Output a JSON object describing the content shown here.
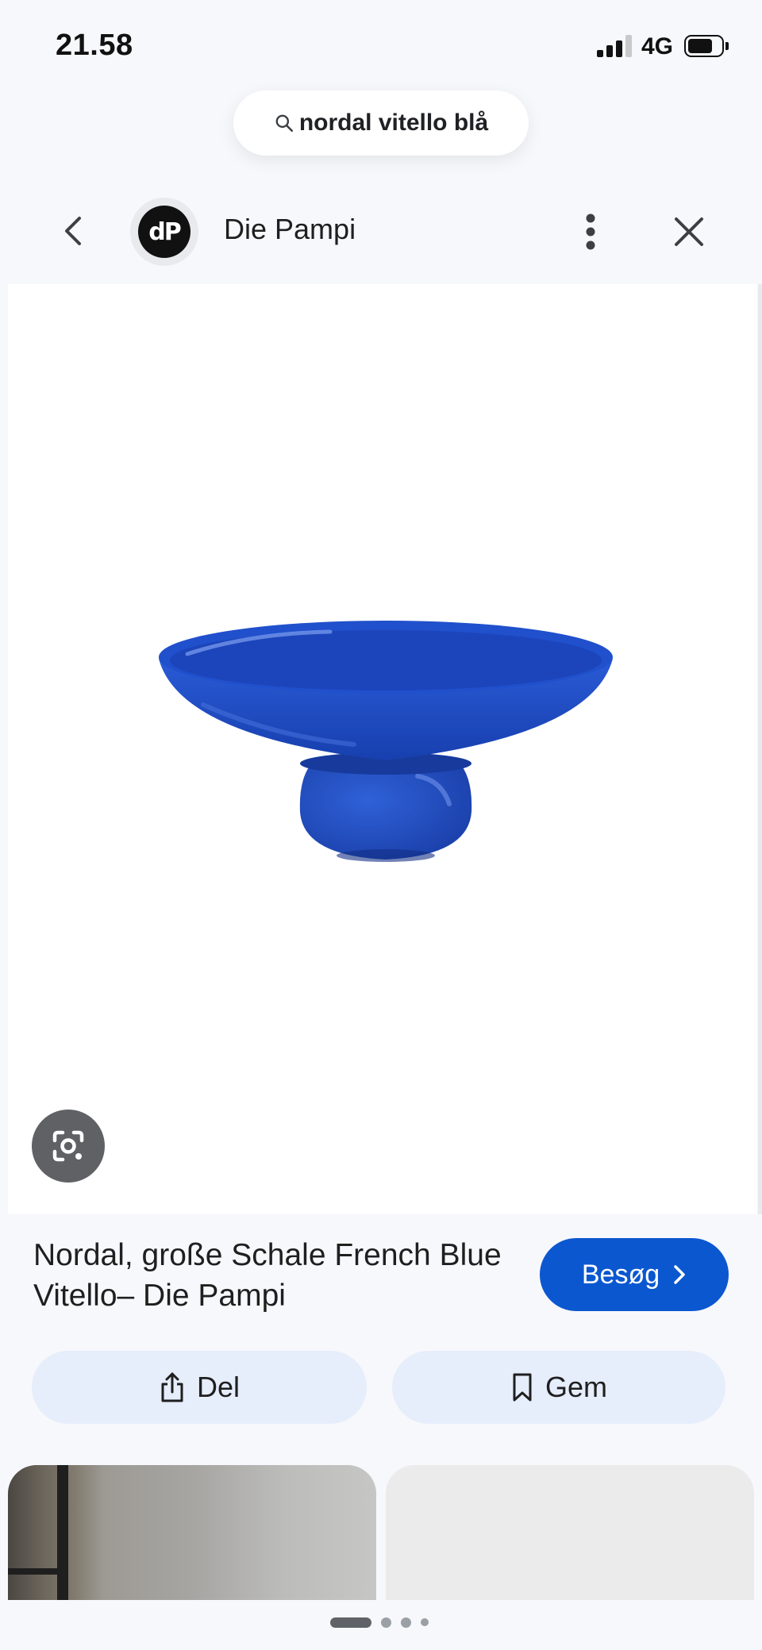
{
  "status_bar": {
    "time": "21.58",
    "network": "4G"
  },
  "search": {
    "query": "nordal vitello blå"
  },
  "header": {
    "source_name": "Die Pampi",
    "avatar_text": "dP"
  },
  "product": {
    "title": "Nordal, große Schale French Blue Vitello– Die Pampi",
    "visit_label": "Besøg",
    "color": "#1f4fc1"
  },
  "actions": {
    "share_label": "Del",
    "save_label": "Gem"
  },
  "colors": {
    "accent": "#0b57d0",
    "action_bg": "#e6edfb"
  },
  "page_indicator": {
    "count": 4,
    "active_index": 0
  }
}
